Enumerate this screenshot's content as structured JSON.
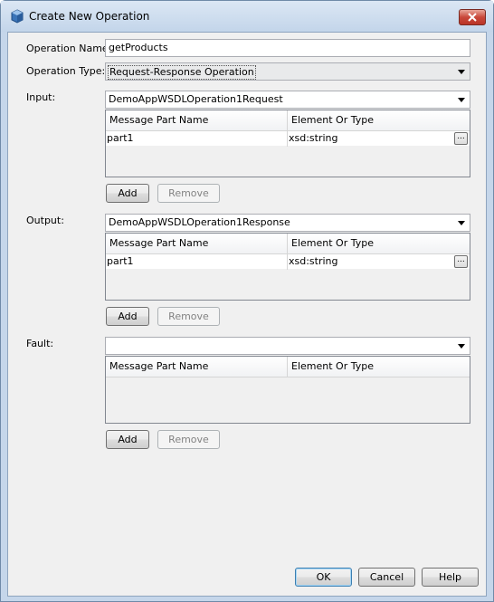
{
  "window": {
    "title": "Create New Operation"
  },
  "form": {
    "operation_name_label": "Operation Name:",
    "operation_name_value": "getProducts",
    "operation_type_label": "Operation Type:",
    "operation_type_value": "Request-Response Operation"
  },
  "input": {
    "label": "Input:",
    "message": "DemoAppWSDLOperation1Request",
    "columns": [
      "Message Part Name",
      "Element Or Type"
    ],
    "rows": [
      {
        "part": "part1",
        "type": "xsd:string"
      }
    ],
    "add_label": "Add",
    "remove_label": "Remove"
  },
  "output": {
    "label": "Output:",
    "message": "DemoAppWSDLOperation1Response",
    "columns": [
      "Message Part Name",
      "Element Or Type"
    ],
    "rows": [
      {
        "part": "part1",
        "type": "xsd:string"
      }
    ],
    "add_label": "Add",
    "remove_label": "Remove"
  },
  "fault": {
    "label": "Fault:",
    "message": "",
    "columns": [
      "Message Part Name",
      "Element Or Type"
    ],
    "add_label": "Add",
    "remove_label": "Remove"
  },
  "buttons": {
    "ok": "OK",
    "cancel": "Cancel",
    "help": "Help"
  },
  "ellipsis_label": "...",
  "icons": {
    "title": "cube-icon",
    "close": "close-icon",
    "dropdown": "chevron-down-icon",
    "browse": "ellipsis-icon"
  },
  "colors": {
    "titlebar": "#c5d6ea",
    "close_button": "#c9483a",
    "dialog_bg": "#f0f0f0"
  }
}
